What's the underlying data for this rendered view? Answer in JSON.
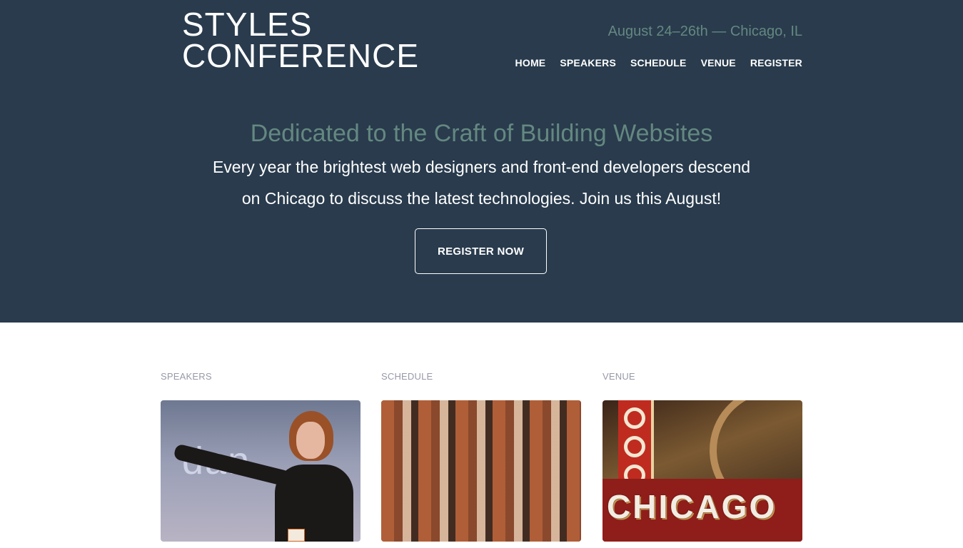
{
  "header": {
    "logo_line1": "STYLES",
    "logo_line2": "CONFERENCE",
    "tagline": "August 24–26th — Chicago, IL",
    "nav": [
      "HOME",
      "SPEAKERS",
      "SCHEDULE",
      "VENUE",
      "REGISTER"
    ]
  },
  "hero": {
    "headline": "Dedicated to the Craft of Building Websites",
    "lead": "Every year the brightest web designers and front-end developers descend on Chicago to discuss the latest technologies. Join us this August!",
    "cta": "REGISTER NOW"
  },
  "teasers": [
    {
      "title": "SPEAKERS"
    },
    {
      "title": "SCHEDULE"
    },
    {
      "title": "VENUE"
    }
  ],
  "images": {
    "speakers_screen_text": "dan",
    "venue_sign_text": "CHICAGO"
  },
  "colors": {
    "hero_bg": "#293b4d",
    "accent": "#648880",
    "label_gray": "#9799a7"
  }
}
